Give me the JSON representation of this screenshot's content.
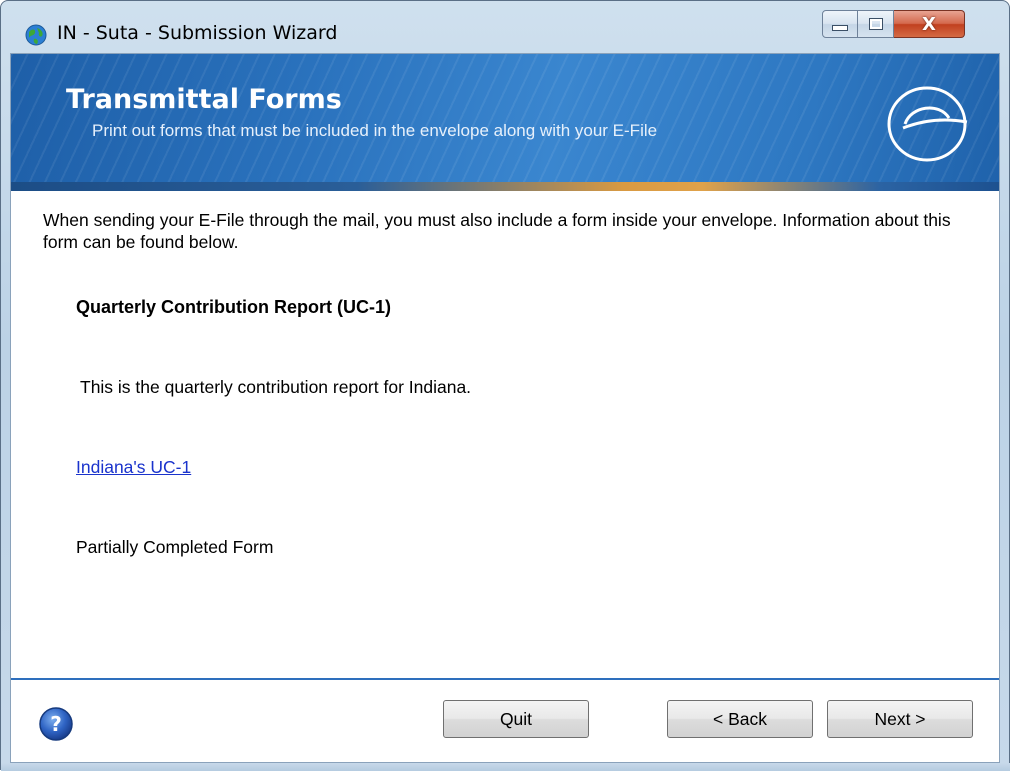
{
  "window": {
    "title": "IN - Suta - Submission Wizard",
    "controls": {
      "minimize": "minimize",
      "maximize": "maximize",
      "close": "X"
    }
  },
  "banner": {
    "title": "Transmittal Forms",
    "subtitle": "Print out forms that must be included in the envelope along with your E-File",
    "logo_icon": "e-logo-icon"
  },
  "content": {
    "intro": "When sending your E-File through the mail, you must also include a form inside your envelope. Information about this form can be found below.",
    "form_title": "Quarterly Contribution Report (UC-1)",
    "form_description": "This is the quarterly contribution report for Indiana.",
    "form_link": "Indiana's UC-1",
    "form_status": "Partially Completed Form"
  },
  "footer": {
    "help_icon": "help-icon",
    "quit_label": "Quit",
    "back_label": "< Back",
    "next_label": "Next >"
  },
  "colors": {
    "banner_blue": "#2a72bd",
    "link": "#1a33cc",
    "separator": "#2e6fbd"
  }
}
